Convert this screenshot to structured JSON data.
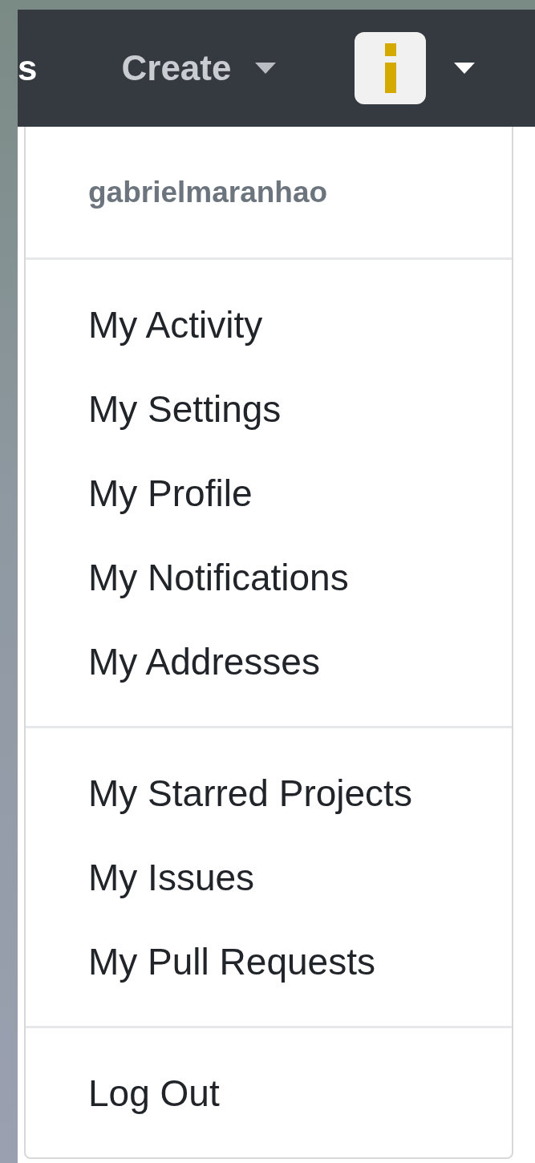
{
  "navbar": {
    "links": [
      {
        "label": "s",
        "caret": false
      },
      {
        "label": "Create",
        "caret": true
      }
    ],
    "account_caret": true
  },
  "user_menu": {
    "username": "gabrielmaranhao",
    "groups": [
      [
        {
          "label": "My Activity"
        },
        {
          "label": "My Settings"
        },
        {
          "label": "My Profile"
        },
        {
          "label": "My Notifications"
        },
        {
          "label": "My Addresses"
        }
      ],
      [
        {
          "label": "My Starred Projects"
        },
        {
          "label": "My Issues"
        },
        {
          "label": "My Pull Requests"
        }
      ],
      [
        {
          "label": "Log Out"
        }
      ]
    ]
  }
}
